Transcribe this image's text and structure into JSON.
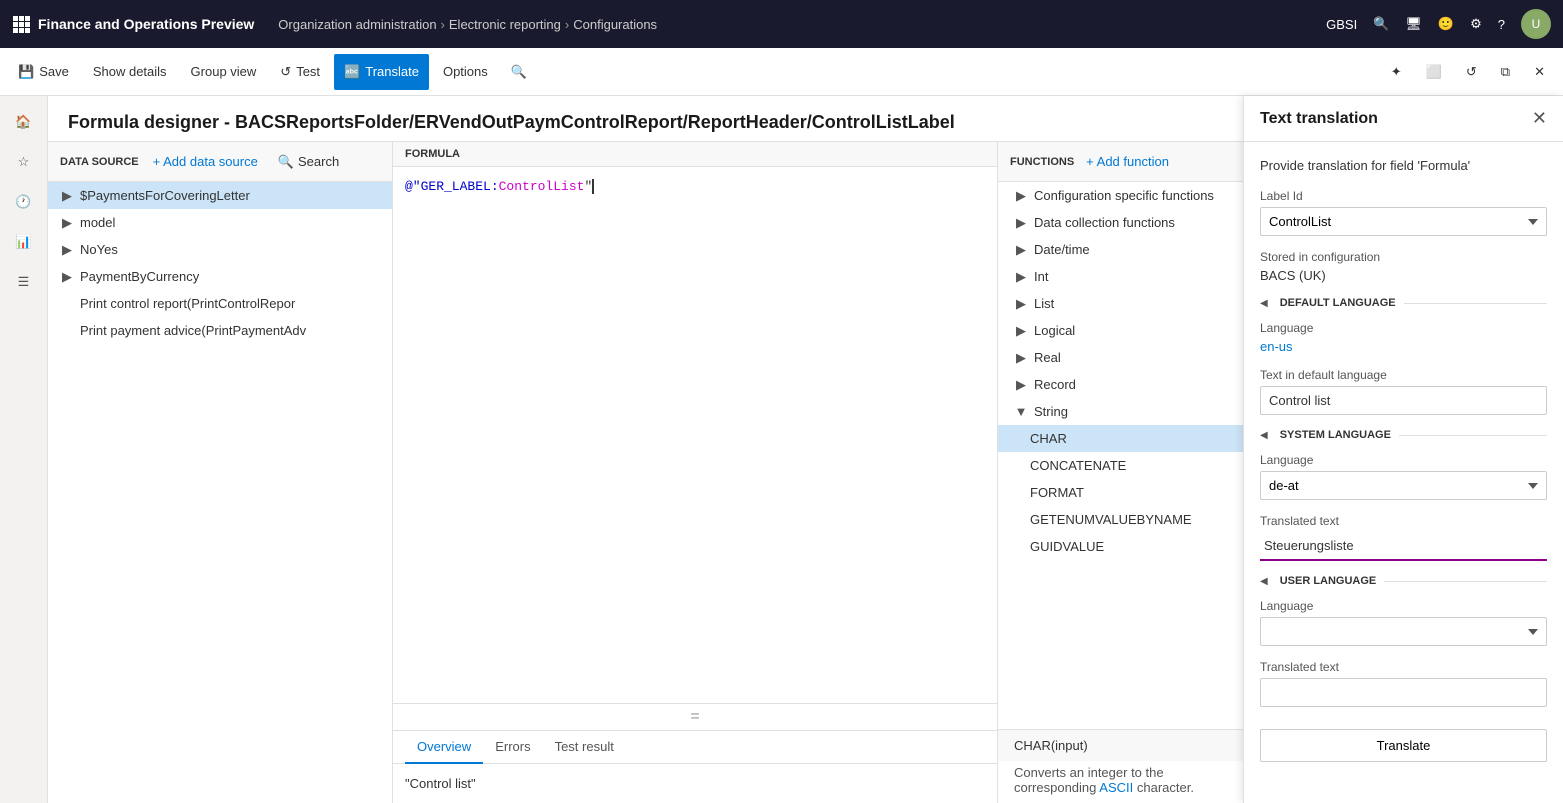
{
  "app": {
    "title": "Finance and Operations Preview",
    "grid_icon": "grid-icon"
  },
  "breadcrumb": {
    "items": [
      {
        "label": "Organization administration",
        "sep": "›"
      },
      {
        "label": "Electronic reporting",
        "sep": "›"
      },
      {
        "label": "Configurations"
      }
    ]
  },
  "top_actions": {
    "company": "GBSI",
    "icons": [
      "search-icon",
      "notifications-icon",
      "smiley-icon",
      "settings-icon",
      "help-icon"
    ]
  },
  "toolbar": {
    "save_label": "Save",
    "show_details_label": "Show details",
    "group_view_label": "Group view",
    "test_label": "Test",
    "translate_label": "Translate",
    "options_label": "Options",
    "search_label": "Search"
  },
  "sidebar": {
    "icons": [
      "home",
      "star",
      "clock",
      "chart",
      "list"
    ]
  },
  "page_title": "Formula designer - BACSReportsFolder/ERVendOutPaymControlReport/ReportHeader/ControlListLabel",
  "data_source": {
    "label": "DATA SOURCE",
    "add_btn": "+ Add data source",
    "search_btn": "Search",
    "items": [
      {
        "label": "$PaymentsForCoveringLetter",
        "indent": 0,
        "hasChevron": true,
        "selected": true
      },
      {
        "label": "model",
        "indent": 0,
        "hasChevron": true
      },
      {
        "label": "NoYes",
        "indent": 0,
        "hasChevron": true
      },
      {
        "label": "PaymentByCurrency",
        "indent": 0,
        "hasChevron": true
      },
      {
        "label": "Print control report(PrintControlRepor",
        "indent": 0,
        "hasChevron": false
      },
      {
        "label": "Print payment advice(PrintPaymentAdv",
        "indent": 0,
        "hasChevron": false
      }
    ]
  },
  "formula": {
    "label": "FORMULA",
    "content_plain": "@\"GER_LABEL:ControlList\"",
    "content_styled": [
      {
        "text": "@\"GER_LABEL:",
        "type": "normal"
      },
      {
        "text": "ControlList",
        "type": "highlight"
      },
      {
        "text": "\"",
        "type": "cursor"
      }
    ]
  },
  "bottom_tabs": [
    {
      "label": "Overview",
      "active": true
    },
    {
      "label": "Errors"
    },
    {
      "label": "Test result"
    }
  ],
  "bottom_content": "\"Control list\"",
  "functions": {
    "label": "FUNCTIONS",
    "add_btn": "+ Add function",
    "items": [
      {
        "label": "Configuration specific functions",
        "indent": 0,
        "hasChevron": true
      },
      {
        "label": "Data collection functions",
        "indent": 0,
        "hasChevron": true
      },
      {
        "label": "Date/time",
        "indent": 0,
        "hasChevron": true
      },
      {
        "label": "Int",
        "indent": 0,
        "hasChevron": true
      },
      {
        "label": "List",
        "indent": 0,
        "hasChevron": true
      },
      {
        "label": "Logical",
        "indent": 0,
        "hasChevron": true
      },
      {
        "label": "Real",
        "indent": 0,
        "hasChevron": true
      },
      {
        "label": "Record",
        "indent": 0,
        "hasChevron": true
      },
      {
        "label": "String",
        "indent": 0,
        "hasChevron": true,
        "expanded": true
      },
      {
        "label": "CHAR",
        "indent": 1,
        "hasChevron": false,
        "selected": true
      },
      {
        "label": "CONCATENATE",
        "indent": 1,
        "hasChevron": false
      },
      {
        "label": "FORMAT",
        "indent": 1,
        "hasChevron": false
      },
      {
        "label": "GETENUMVALUEBYNAME",
        "indent": 1,
        "hasChevron": false
      },
      {
        "label": "GUIDVALUE",
        "indent": 1,
        "hasChevron": false
      }
    ]
  },
  "fn_info": {
    "signature": "CHAR(input)",
    "description": "Converts an integer to the corresponding",
    "description2": "ASCII",
    "description3": "character."
  },
  "right_panel": {
    "title": "Text translation",
    "field_desc": "Provide translation for field 'Formula'",
    "close_icon": "close-icon",
    "label_id_label": "Label Id",
    "label_id_value": "ControlList",
    "stored_in_label": "Stored in configuration",
    "stored_in_value": "BACS (UK)",
    "default_lang_section": "DEFAULT LANGUAGE",
    "language_label": "Language",
    "default_lang_value": "en-us",
    "text_in_default_label": "Text in default language",
    "text_in_default_value": "Control list",
    "system_lang_section": "SYSTEM LANGUAGE",
    "system_lang_value": "de-at",
    "translated_text_label": "Translated text",
    "translated_text_value": "Steuerungsliste",
    "user_lang_section": "USER LANGUAGE",
    "user_lang_value": "",
    "user_translated_text": "",
    "translate_btn": "Translate"
  }
}
